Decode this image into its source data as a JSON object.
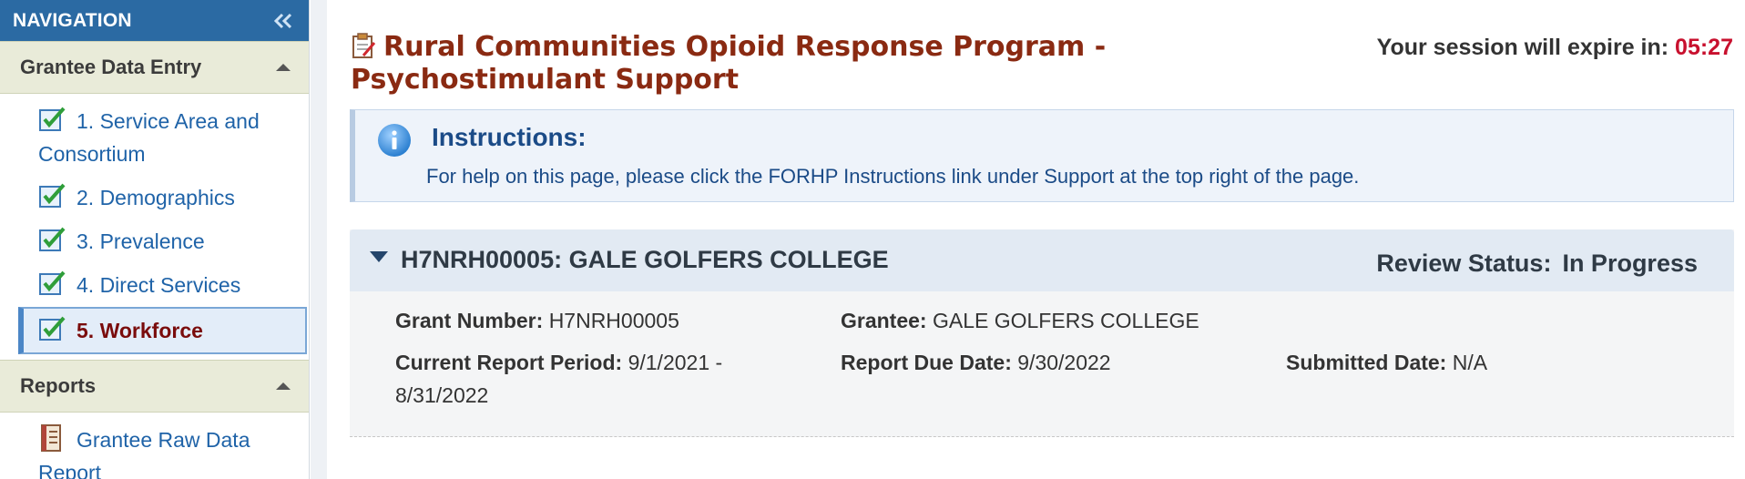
{
  "sidebar": {
    "title": "NAVIGATION",
    "sections": [
      {
        "label": "Grantee Data Entry",
        "items": [
          {
            "label": "1. Service Area and Consortium",
            "active": false
          },
          {
            "label": "2. Demographics",
            "active": false
          },
          {
            "label": "3. Prevalence",
            "active": false
          },
          {
            "label": "4. Direct Services",
            "active": false
          },
          {
            "label": "5. Workforce",
            "active": true
          }
        ]
      },
      {
        "label": "Reports",
        "items": [
          {
            "label": "Grantee Raw Data Report"
          }
        ]
      }
    ]
  },
  "main": {
    "title": "Rural Communities Opioid Response Program - Psychostimulant Support",
    "session": {
      "label": "Your session will expire in:",
      "time": "05:27"
    },
    "instructions": {
      "title": "Instructions:",
      "text": "For help on this page, please click the FORHP Instructions link under Support at the top right of the page."
    },
    "grant": {
      "header": "H7NRH00005: GALE GOLFERS COLLEGE",
      "review_label": "Review Status:",
      "review_value": "In Progress",
      "fields": {
        "grant_number": {
          "label": "Grant Number:",
          "value": "H7NRH00005"
        },
        "grantee": {
          "label": "Grantee:",
          "value": "GALE GOLFERS COLLEGE"
        },
        "report_period": {
          "label": "Current Report Period:",
          "value": "9/1/2021 - 8/31/2022"
        },
        "due_date": {
          "label": "Report Due Date:",
          "value": "9/30/2022"
        },
        "submitted_date": {
          "label": "Submitted Date:",
          "value": "N/A"
        }
      }
    }
  },
  "colors": {
    "nav_header": "#2b6aa3",
    "title": "#8a2a12",
    "session_time": "#c8102e",
    "link": "#1f63a8",
    "active_item": "#7a0c0c"
  }
}
